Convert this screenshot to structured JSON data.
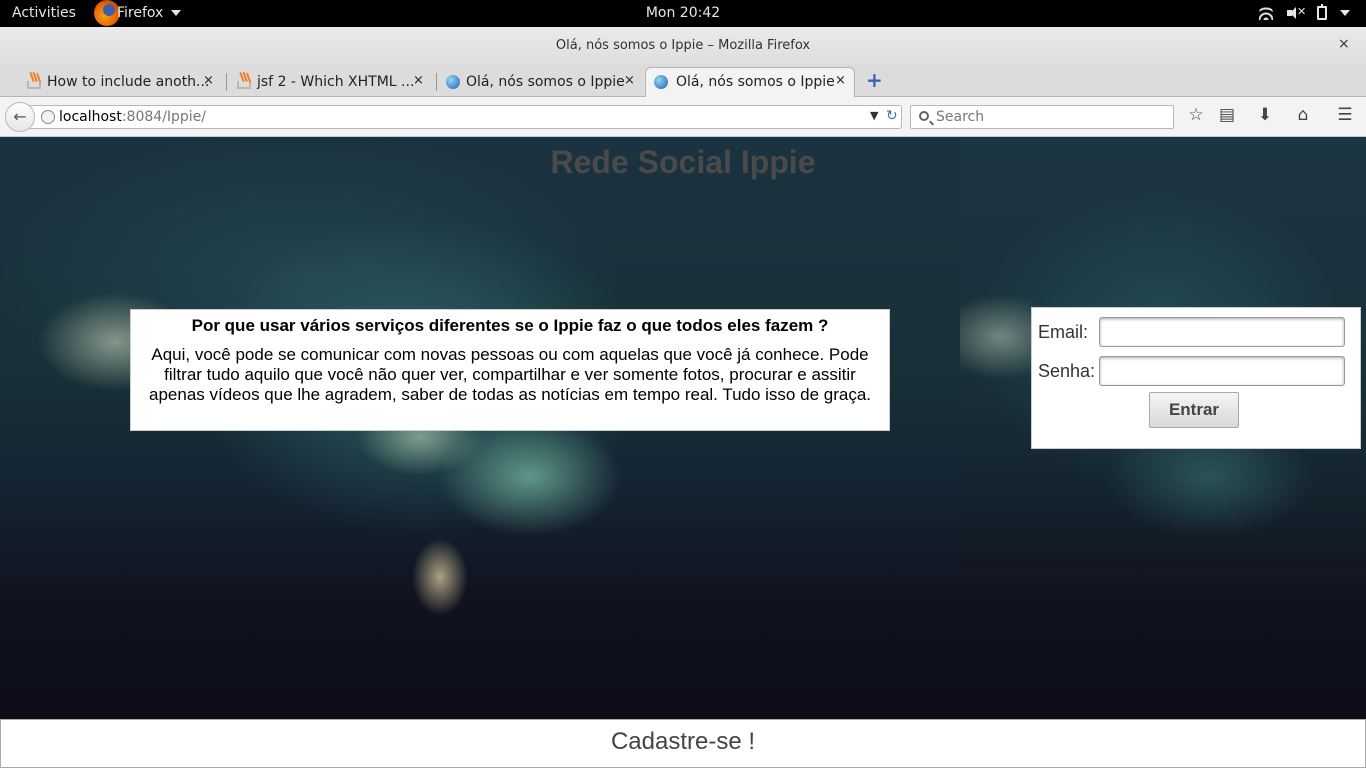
{
  "topbar": {
    "activities": "Activities",
    "app": "Firefox",
    "clock": "Mon 20:42",
    "icons": [
      "firefox-logo-icon",
      "wifi-icon",
      "volume-muted-icon",
      "battery-icon",
      "system-menu-icon"
    ]
  },
  "window": {
    "title": "Olá, nós somos o Ippie – Mozilla Firefox",
    "close": "×"
  },
  "tabs": [
    {
      "label": "How to include anoth...",
      "icon": "stackoverflow-icon"
    },
    {
      "label": "jsf 2 - Which XHTML ...",
      "icon": "stackoverflow-icon"
    },
    {
      "label": "Olá, nós somos o Ippie",
      "icon": "globe-icon"
    },
    {
      "label": "Olá, nós somos o Ippie",
      "icon": "globe-icon",
      "active": true
    }
  ],
  "tab_close": "×",
  "new_tab": "+",
  "navbar": {
    "back": "←",
    "url_host": "localhost",
    "url_rest": ":8084/Ippie/",
    "search_placeholder": "Search",
    "dropdown": "▼",
    "reload": "↻"
  },
  "toolbar_icons": {
    "bookmark": "☆",
    "reading_list": "▤",
    "download": "⬇",
    "home": "⌂",
    "menu": "☰"
  },
  "page": {
    "title": "Rede Social Ippie",
    "intro_question": "Por que usar vários serviços diferentes se o Ippie faz o que todos eles fazem ?",
    "intro_text": "Aqui, você pode se comunicar com novas pessoas ou com aquelas que você já conhece. Pode filtrar tudo aquilo que você não quer ver, compartilhar e ver somente fotos, procurar e assitir apenas vídeos que lhe agradem, saber de todas as notícias em tempo real. Tudo isso de graça.",
    "login": {
      "email_label": "Email:",
      "password_label": "Senha:",
      "email_value": "",
      "password_value": "",
      "submit": "Entrar"
    },
    "signup": "Cadastre-se !"
  }
}
